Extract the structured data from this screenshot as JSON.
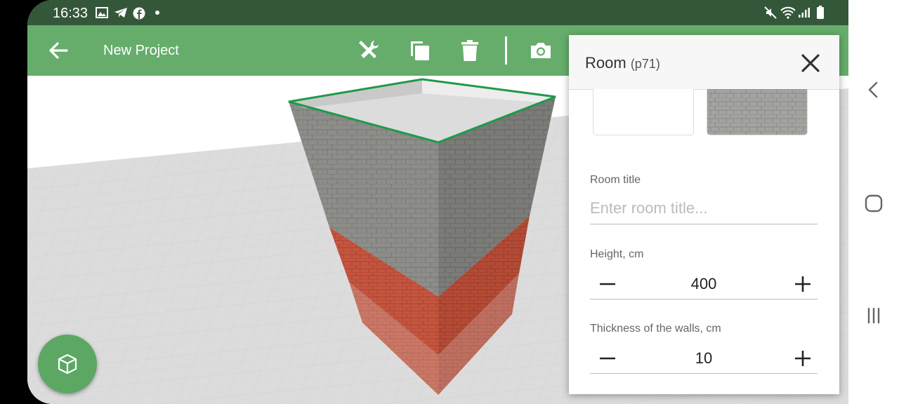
{
  "status_bar": {
    "time": "16:33",
    "left_icons": [
      "gallery-icon",
      "telegram-icon",
      "facebook-icon",
      "dot-icon"
    ],
    "right_icons": [
      "mute-icon",
      "wifi-icon",
      "signal-icon",
      "battery-icon"
    ]
  },
  "toolbar": {
    "title": "New Project",
    "buttons": [
      "back-arrow-icon",
      "tools-icon",
      "copy-icon",
      "trash-icon",
      "camera-icon"
    ]
  },
  "panel": {
    "title": "Room",
    "subtitle": "(p71)",
    "room_title_label": "Room title",
    "room_title_placeholder": "Enter room title...",
    "room_title_value": "",
    "height_label": "Height, cm",
    "height_value": "400",
    "thickness_label": "Thickness of the walls, cm",
    "thickness_value": "10"
  },
  "fab": {
    "icon": "cube-icon"
  },
  "navbar": {
    "buttons": [
      "back-chevron-icon",
      "home-icon",
      "recents-icon"
    ]
  },
  "colors": {
    "status_bar": "#34573a",
    "toolbar": "#66ad6b",
    "fab": "#5da765",
    "selection_outline": "#1f9a4a",
    "brick_red": "#c5553f",
    "stone_gray": "#8f8f8c"
  }
}
